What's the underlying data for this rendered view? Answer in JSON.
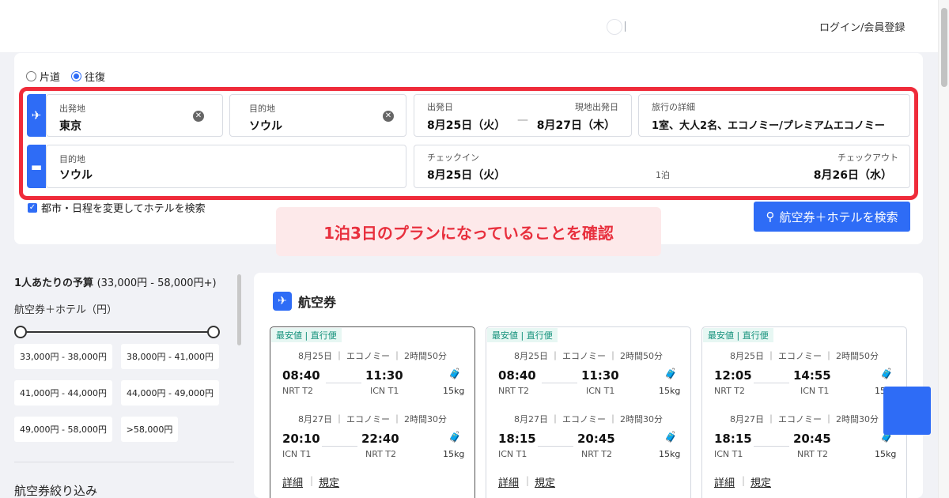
{
  "header": {
    "login_label": "ログイン/会員登録"
  },
  "trip_type": {
    "one_way": "片道",
    "round_trip": "往復",
    "selected": "往復"
  },
  "flight": {
    "origin_label": "出発地",
    "origin_value": "東京",
    "destination_label": "目的地",
    "destination_value": "ソウル",
    "depart_label": "出発日",
    "depart_value": "8月25日（火）",
    "dash": "—",
    "return_label": "現地出発日",
    "return_value": "8月27日（木）",
    "details_label": "旅行の詳細",
    "details_value": "1室、大人2名、エコノミー/プレミアムエコノミー"
  },
  "hotel": {
    "destination_label": "目的地",
    "destination_value": "ソウル",
    "checkin_label": "チェックイン",
    "checkin_value": "8月25日（火）",
    "nights": "1泊",
    "checkout_label": "チェックアウト",
    "checkout_value": "8月26日（水）"
  },
  "hotel_checkbox_label": "都市・日程を変更してホテルを検索",
  "search_button_label": "航空券＋ホテルを検索",
  "annotation": "1泊3日のプランになっていることを確認",
  "sidebar": {
    "budget_title": "1人あたりの予算",
    "budget_range": "(33,000円 - 58,000円+)",
    "budget_sub": "航空券＋ホテル（円）",
    "chips": [
      "33,000円 - 38,000円",
      "38,000円 - 41,000円",
      "41,000円 - 44,000円",
      "44,000円 - 49,000円",
      "49,000円 - 58,000円",
      ">58,000円"
    ],
    "filter_title": "航空券絞り込み"
  },
  "results": {
    "title": "航空券",
    "cards": [
      {
        "tag": "最安値 | 直行便",
        "out": {
          "meta": "8月25日 ｜ エコノミー ｜ 2時間50分",
          "dep": "08:40",
          "arr": "11:30",
          "dep_apt": "NRT T2",
          "arr_apt": "ICN T1",
          "bag": "15kg"
        },
        "ret": {
          "meta": "8月27日 ｜ エコノミー ｜ 2時間30分",
          "dep": "20:10",
          "arr": "22:40",
          "dep_apt": "ICN T1",
          "arr_apt": "NRT T2",
          "bag": "15kg"
        },
        "detail": "詳細",
        "rules": "規定"
      },
      {
        "tag": "最安値 | 直行便",
        "out": {
          "meta": "8月25日 ｜ エコノミー ｜ 2時間50分",
          "dep": "08:40",
          "arr": "11:30",
          "dep_apt": "NRT T2",
          "arr_apt": "ICN T1",
          "bag": "15kg"
        },
        "ret": {
          "meta": "8月27日 ｜ エコノミー ｜ 2時間30分",
          "dep": "18:15",
          "arr": "20:45",
          "dep_apt": "ICN T1",
          "arr_apt": "NRT T2",
          "bag": "15kg"
        },
        "detail": "詳細",
        "rules": "規定"
      },
      {
        "tag": "最安値 | 直行便",
        "out": {
          "meta": "8月25日 ｜ エコノミー ｜ 2時間50分",
          "dep": "12:05",
          "arr": "14:55",
          "dep_apt": "NRT T2",
          "arr_apt": "ICN T1",
          "bag": "15"
        },
        "ret": {
          "meta": "8月27日 ｜ エコノミー ｜ 2時間30分",
          "dep": "18:15",
          "arr": "20:45",
          "dep_apt": "ICN T1",
          "arr_apt": "NRT T2",
          "bag": "15kg"
        },
        "detail": "詳細",
        "rules": "規定"
      }
    ]
  },
  "colors": {
    "accent": "#2e6cf6",
    "highlight": "#ef2b3a",
    "tag_text": "#12907a"
  }
}
